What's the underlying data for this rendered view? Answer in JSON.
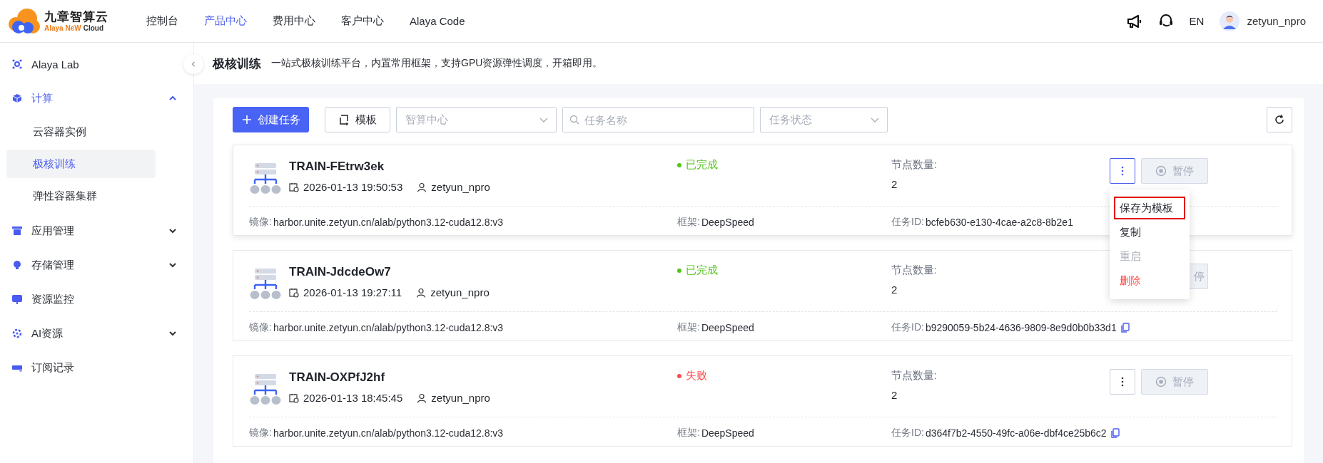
{
  "logo": {
    "name": "九章智算云",
    "brand": "Alaya NeW",
    "suffix": "Cloud"
  },
  "nav": [
    {
      "label": "控制台",
      "selected": false
    },
    {
      "label": "产品中心",
      "selected": true
    },
    {
      "label": "费用中心",
      "selected": false
    },
    {
      "label": "客户中心",
      "selected": false
    },
    {
      "label": "Alaya Code",
      "selected": false
    }
  ],
  "header_right": {
    "language": "EN",
    "username": "zetyun_npro"
  },
  "sidebar": {
    "items": [
      {
        "label": "Alaya Lab",
        "kind": "link"
      },
      {
        "label": "计算",
        "kind": "group",
        "expanded": true,
        "children": [
          {
            "label": "云容器实例",
            "selected": false
          },
          {
            "label": "极核训练",
            "selected": true
          },
          {
            "label": "弹性容器集群",
            "selected": false
          }
        ]
      },
      {
        "label": "应用管理",
        "kind": "group",
        "expanded": false
      },
      {
        "label": "存储管理",
        "kind": "group",
        "expanded": false
      },
      {
        "label": "资源监控",
        "kind": "link"
      },
      {
        "label": "AI资源",
        "kind": "group",
        "expanded": false
      },
      {
        "label": "订阅记录",
        "kind": "link"
      }
    ]
  },
  "page": {
    "title": "极核训练",
    "description": "一站式极核训练平台，内置常用框架，支持GPU资源弹性调度，开箱即用。"
  },
  "toolbar": {
    "create": "创建任务",
    "template": "模板",
    "center_placeholder": "智算中心",
    "search_placeholder": "任务名称",
    "status_placeholder": "任务状态"
  },
  "tasks": [
    {
      "name": "TRAIN-FEtrw3ek",
      "time": "2026-01-13 19:50:53",
      "user": "zetyun_npro",
      "status": "已完成",
      "color": "#52c41a",
      "nodes_label": "节点数量:",
      "nodes": "2",
      "image_label": "镜像:",
      "image": "harbor.unite.zetyun.cn/alab/python3.12-cuda12.8:v3",
      "framework_label": "框架:",
      "framework": "DeepSpeed",
      "id_label": "任务ID:",
      "id": "bcfeb630-e130-4cae-a2c8-8b2e1",
      "copy": false,
      "more": {
        "active": true
      },
      "pause": {
        "label": "暂停",
        "icon": true
      },
      "menu": [
        {
          "label": "保存为模板",
          "kind": "normal",
          "highlighted": true
        },
        {
          "label": "复制",
          "kind": "normal",
          "highlighted": false
        },
        {
          "label": "重启",
          "kind": "disabled",
          "highlighted": false
        },
        {
          "label": "删除",
          "kind": "danger",
          "highlighted": false
        }
      ]
    },
    {
      "name": "TRAIN-JdcdeOw7",
      "time": "2026-01-13 19:27:11",
      "user": "zetyun_npro",
      "status": "已完成",
      "color": "#52c41a",
      "nodes_label": "节点数量:",
      "nodes": "2",
      "image_label": "镜像:",
      "image": "harbor.unite.zetyun.cn/alab/python3.12-cuda12.8:v3",
      "framework_label": "框架:",
      "framework": "DeepSpeed",
      "id_label": "任务ID:",
      "id": "b9290059-5b24-4636-9809-8e9d0b0b33d1",
      "copy": true,
      "pause": {
        "label": "停",
        "icon": false
      }
    },
    {
      "name": "TRAIN-OXPfJ2hf",
      "time": "2026-01-13 18:45:45",
      "user": "zetyun_npro",
      "status": "失败",
      "color": "#ff4d4f",
      "nodes_label": "节点数量:",
      "nodes": "2",
      "image_label": "镜像:",
      "image": "harbor.unite.zetyun.cn/alab/python3.12-cuda12.8:v3",
      "framework_label": "框架:",
      "framework": "DeepSpeed",
      "id_label": "任务ID:",
      "id": "d364f7b2-4550-49fc-a06e-dbf4ce25b6c2",
      "copy": true,
      "more": {
        "active": false
      },
      "pause": {
        "label": "暂停",
        "icon": true
      }
    }
  ]
}
